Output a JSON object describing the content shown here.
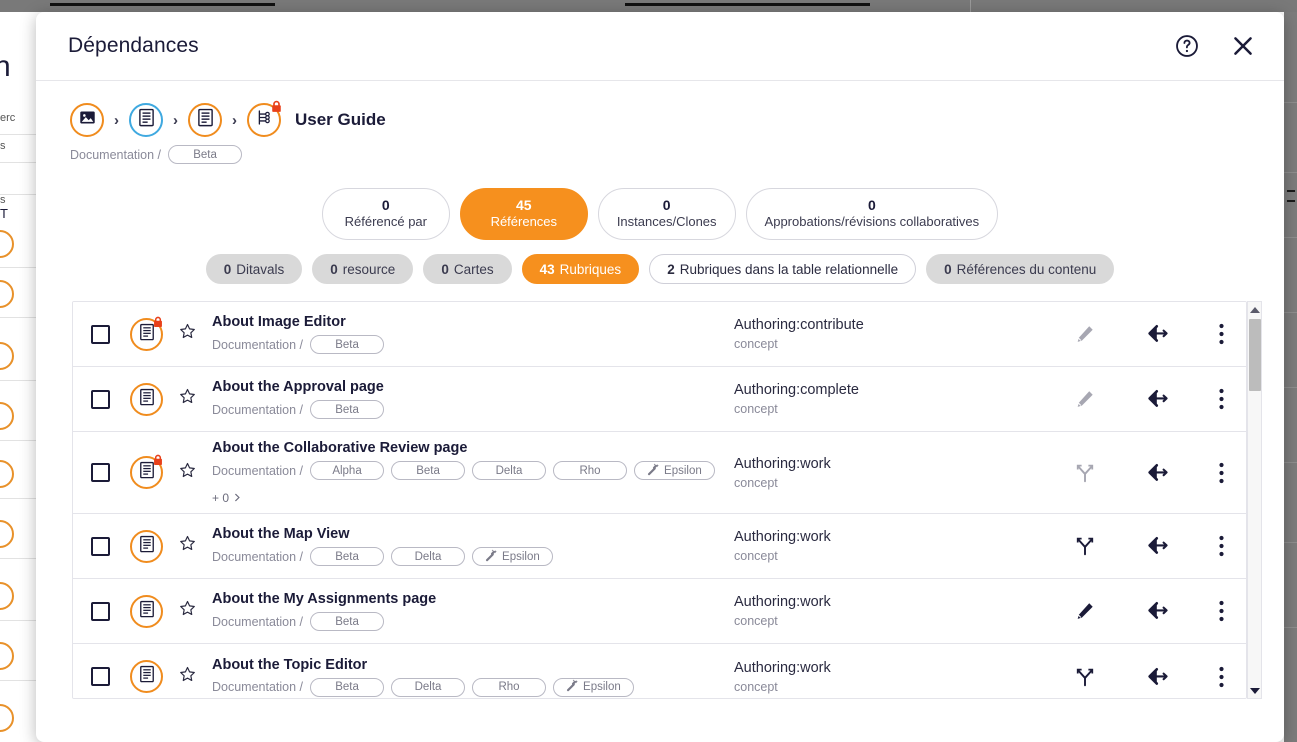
{
  "background": {
    "title_fragment": "n",
    "text_fragments": [
      "erc",
      "s",
      "s",
      "T"
    ]
  },
  "modal": {
    "title": "Dépendances",
    "help_icon": "help-circle-icon",
    "close_icon": "close-icon"
  },
  "breadcrumb": {
    "items": [
      {
        "icon": "image-icon",
        "ring": "orange",
        "lock": false
      },
      {
        "icon": "document-icon",
        "ring": "blue",
        "lock": false
      },
      {
        "icon": "document-icon",
        "ring": "orange",
        "lock": false
      },
      {
        "icon": "map-branch-icon",
        "ring": "orange",
        "lock": true
      }
    ],
    "separator": "›",
    "label": "User Guide",
    "sub_path": "Documentation /",
    "sub_tag": "Beta"
  },
  "stats": [
    {
      "count": "0",
      "label": "Référencé par",
      "active": false
    },
    {
      "count": "45",
      "label": "Références",
      "active": true
    },
    {
      "count": "0",
      "label": "Instances/Clones",
      "active": false
    },
    {
      "count": "0",
      "label": "Approbations/révisions collaboratives",
      "active": false
    }
  ],
  "chips": [
    {
      "count": "0",
      "label": "Ditavals",
      "style": "grey"
    },
    {
      "count": "0",
      "label": "resource",
      "style": "grey"
    },
    {
      "count": "0",
      "label": "Cartes",
      "style": "grey"
    },
    {
      "count": "43",
      "label": "Rubriques",
      "style": "active"
    },
    {
      "count": "2",
      "label": "Rubriques dans la table relationnelle",
      "style": "outline"
    },
    {
      "count": "0",
      "label": "Références du contenu",
      "style": "grey"
    }
  ],
  "table": {
    "path_prefix": "Documentation /",
    "rows": [
      {
        "title": "About Image Editor",
        "locked": true,
        "tags": [
          {
            "label": "Beta",
            "wand": false
          }
        ],
        "more": null,
        "status": "Authoring:contribute",
        "type": "concept",
        "first_action": "edit-pencil-icon",
        "first_action_dim": true
      },
      {
        "title": "About the Approval page",
        "locked": false,
        "tags": [
          {
            "label": "Beta",
            "wand": false
          }
        ],
        "more": null,
        "status": "Authoring:complete",
        "type": "concept",
        "first_action": "edit-pencil-icon",
        "first_action_dim": true
      },
      {
        "title": "About the Collaborative Review page",
        "locked": true,
        "tags": [
          {
            "label": "Alpha",
            "wand": false
          },
          {
            "label": "Beta",
            "wand": false
          },
          {
            "label": "Delta",
            "wand": false
          },
          {
            "label": "Rho",
            "wand": false
          },
          {
            "label": "Epsilon",
            "wand": true
          }
        ],
        "more": "+ 0",
        "status": "Authoring:work",
        "type": "concept",
        "first_action": "branch-icon",
        "first_action_dim": true
      },
      {
        "title": "About the Map View",
        "locked": false,
        "tags": [
          {
            "label": "Beta",
            "wand": false
          },
          {
            "label": "Delta",
            "wand": false
          },
          {
            "label": "Epsilon",
            "wand": true
          }
        ],
        "more": null,
        "status": "Authoring:work",
        "type": "concept",
        "first_action": "branch-icon",
        "first_action_dim": false
      },
      {
        "title": "About the My Assignments page",
        "locked": false,
        "tags": [
          {
            "label": "Beta",
            "wand": false
          }
        ],
        "more": null,
        "status": "Authoring:work",
        "type": "concept",
        "first_action": "edit-pencil-icon",
        "first_action_dim": false
      },
      {
        "title": "About the Topic Editor",
        "locked": false,
        "tags": [
          {
            "label": "Beta",
            "wand": false
          },
          {
            "label": "Delta",
            "wand": false
          },
          {
            "label": "Rho",
            "wand": false
          },
          {
            "label": "Epsilon",
            "wand": true
          }
        ],
        "more": null,
        "status": "Authoring:work",
        "type": "concept",
        "first_action": "branch-icon",
        "first_action_dim": false
      }
    ]
  },
  "colors": {
    "accent": "#f6901e",
    "ring": "#f08c1e",
    "ring_blue": "#3fa9e0",
    "lock": "#e8401a",
    "text_dark": "#1b1b38",
    "text_muted": "#8a8a99",
    "chip_grey": "#d9d9d9"
  }
}
